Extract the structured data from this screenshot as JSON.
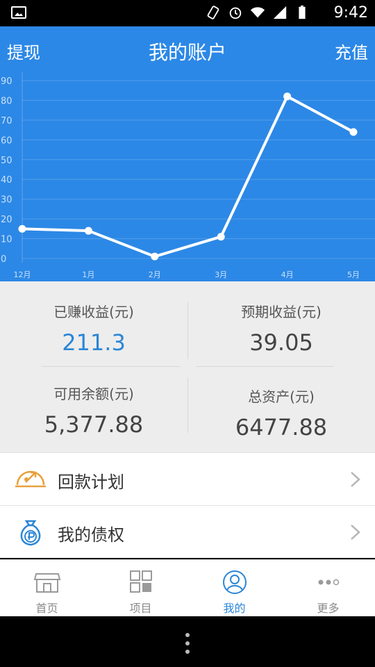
{
  "status_bar": {
    "time": "9:42"
  },
  "header": {
    "title": "我的账户",
    "left_action": "提现",
    "right_action": "充值"
  },
  "chart_data": {
    "type": "line",
    "categories": [
      "12月",
      "1月",
      "2月",
      "3月",
      "4月",
      "5月"
    ],
    "values": [
      15,
      14,
      1,
      11,
      82,
      64
    ],
    "ylim": [
      0,
      90
    ],
    "y_ticks": [
      0,
      10,
      20,
      30,
      40,
      50,
      60,
      70,
      80,
      90
    ],
    "grid": true,
    "line_color": "#ffffff",
    "background": "#2c88e6"
  },
  "stats": {
    "earned_label": "已赚收益(元)",
    "earned_value": "211.3",
    "expected_label": "预期收益(元)",
    "expected_value": "39.05",
    "available_label": "可用余额(元)",
    "available_value": "5,377.88",
    "total_label": "总资产(元)",
    "total_value": "6477.88"
  },
  "menu": [
    {
      "label": "回款计划",
      "icon": "repayment-plan-icon"
    },
    {
      "label": "我的债权",
      "icon": "money-bag-icon"
    }
  ],
  "tabs": [
    {
      "label": "首页",
      "icon": "store-icon"
    },
    {
      "label": "项目",
      "icon": "grid-icon"
    },
    {
      "label": "我的",
      "icon": "user-circle-icon"
    },
    {
      "label": "更多",
      "icon": "more-dots-icon"
    }
  ],
  "colors": {
    "primary": "#2c88e6",
    "accent_text": "#2b86d6",
    "icon_orange": "#e8a03a"
  }
}
